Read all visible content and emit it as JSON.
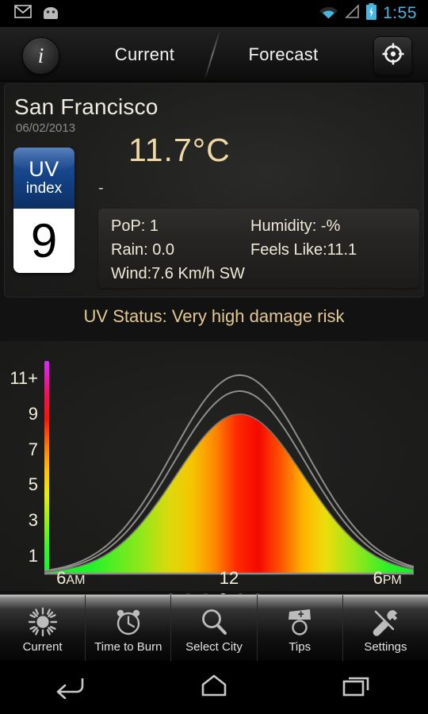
{
  "statusbar": {
    "time": "1:55",
    "icons": [
      "gmail-icon",
      "android-app-icon",
      "wifi-icon",
      "cellular-signal-icon",
      "battery-charging-icon"
    ]
  },
  "actionbar": {
    "info_label": "i",
    "tabs": [
      {
        "label": "Current",
        "active": true
      },
      {
        "label": "Forecast",
        "active": false
      }
    ],
    "gps_icon": "crosshair-location-icon"
  },
  "current": {
    "city": "San Francisco",
    "date": "06/02/2013",
    "temperature": "11.7°C",
    "condition": "-",
    "uv_badge": {
      "line1": "UV",
      "line2": "index",
      "value": "9"
    },
    "details": {
      "pop_label": "PoP: 1",
      "humidity_label": "Humidity:   -%",
      "rain_label": "Rain: 0.0",
      "feels_like_label": "Feels Like:11.1",
      "wind_label": "Wind:7.6 Km/h SW"
    }
  },
  "uv_status": "UV Status: Very high damage risk",
  "chart_data": {
    "type": "area",
    "title": "UV Status: Very high damage risk",
    "xlabel": "",
    "ylabel": "UV Index",
    "ylim": [
      0,
      12
    ],
    "xlim": [
      5,
      19
    ],
    "grid": false,
    "legend": null,
    "y_ticks": [
      "1",
      "3",
      "5",
      "7",
      "9",
      "11+"
    ],
    "y_tick_values": [
      1,
      3,
      5,
      7,
      9,
      11
    ],
    "x_ticks": [
      "6AM",
      "12",
      "6PM"
    ],
    "x_tick_values": [
      6,
      12,
      18
    ],
    "colorbar": [
      "#d42ef0",
      "#f50f55",
      "#ff7a06",
      "#ffc400",
      "#8ef20b",
      "#15f52c"
    ],
    "series": [
      {
        "name": "clear-sky-max",
        "style": "outline",
        "peak_hour": 12.4,
        "peak_value": 11.2,
        "width": 2.55
      },
      {
        "name": "cloud-adjusted",
        "style": "outline",
        "peak_hour": 12.4,
        "peak_value": 10.3,
        "width": 2.5
      },
      {
        "name": "uv-index-forecast",
        "style": "filled-gradient",
        "peak_hour": 12.4,
        "peak_value": 9.0,
        "width": 2.45,
        "x": [
          5.0,
          6.0,
          7.0,
          8.0,
          9.0,
          10.0,
          11.0,
          12.0,
          12.4,
          13.0,
          14.0,
          15.0,
          16.0,
          17.0,
          18.0,
          19.0
        ],
        "y": [
          0.05,
          0.25,
          0.8,
          2.0,
          4.0,
          6.6,
          8.5,
          8.95,
          9.0,
          8.7,
          6.9,
          4.4,
          2.3,
          0.95,
          0.3,
          0.05
        ]
      }
    ]
  },
  "pager": {
    "total": 6,
    "active_index": 3
  },
  "tabbar": [
    {
      "label": "Current",
      "icon": "sun-icon"
    },
    {
      "label": "Time to Burn",
      "icon": "alarm-clock-icon"
    },
    {
      "label": "Select City",
      "icon": "search-icon"
    },
    {
      "label": "Tips",
      "icon": "nurse-hat-icon"
    },
    {
      "label": "Settings",
      "icon": "tools-icon"
    }
  ],
  "navbar": [
    "back-icon",
    "home-icon",
    "recents-icon"
  ],
  "colors": {
    "accent_gold": "#f0d8a4",
    "status_blue": "#48b6e0",
    "uv_badge_blue": "#1e4f98",
    "cream_text": "#f3eeda"
  }
}
